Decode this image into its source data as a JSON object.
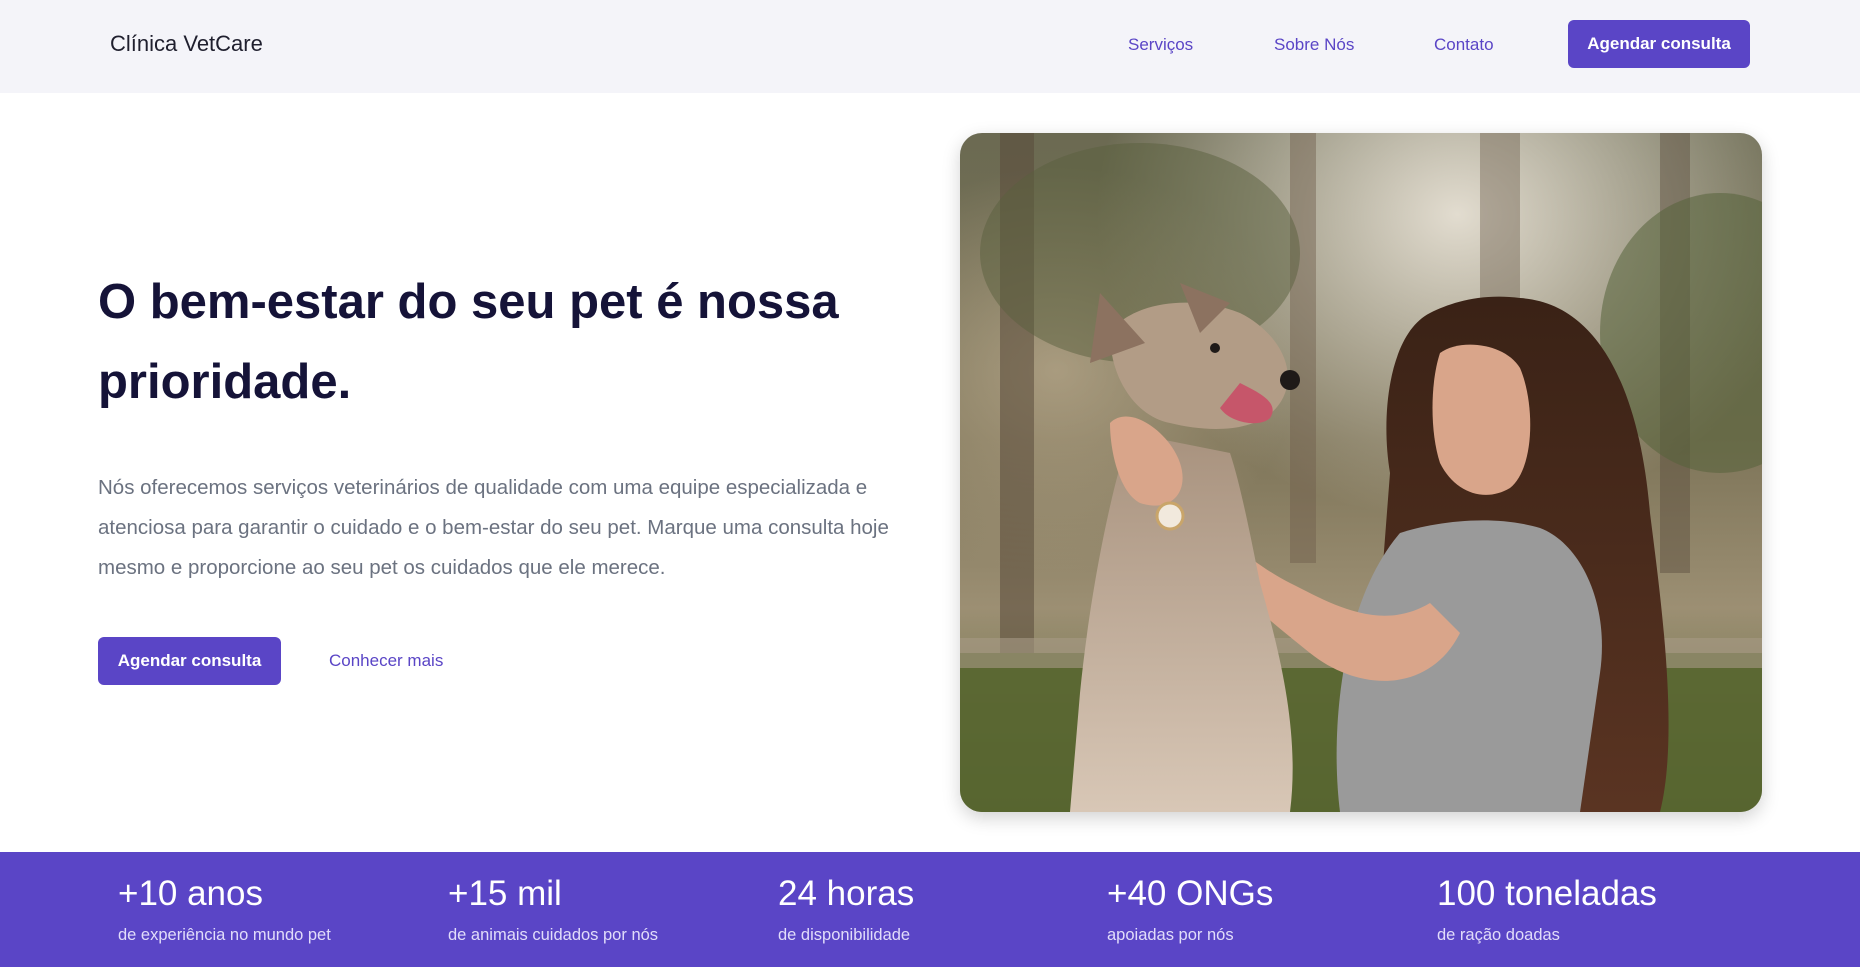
{
  "header": {
    "brand": "Clínica VetCare",
    "nav": [
      "Serviços",
      "Sobre Nós",
      "Contato"
    ],
    "cta": "Agendar consulta"
  },
  "hero": {
    "title": "O bem-estar do seu pet é nossa prioridade.",
    "description": "Nós oferecemos serviços veterinários de qualidade com uma equipe especializada e atenciosa para garantir o cuidado e o bem-estar do seu pet. Marque uma consulta hoje mesmo e proporcione ao seu pet os cuidados que ele merece.",
    "primary_button": "Agendar consulta",
    "secondary_link": "Conhecer mais"
  },
  "stats": [
    {
      "value": "+10 anos",
      "label": "de experiência no mundo pet"
    },
    {
      "value": "+15 mil",
      "label": "de animais cuidados por nós"
    },
    {
      "value": "24 horas",
      "label": "de disponibilidade"
    },
    {
      "value": "+40 ONGs",
      "label": "apoiadas por nós"
    },
    {
      "value": "100 toneladas",
      "label": "de ração doadas"
    }
  ],
  "colors": {
    "accent": "#5a45c6",
    "header_bg": "#f4f4f9",
    "title": "#151338",
    "body_text": "#6b7280"
  }
}
